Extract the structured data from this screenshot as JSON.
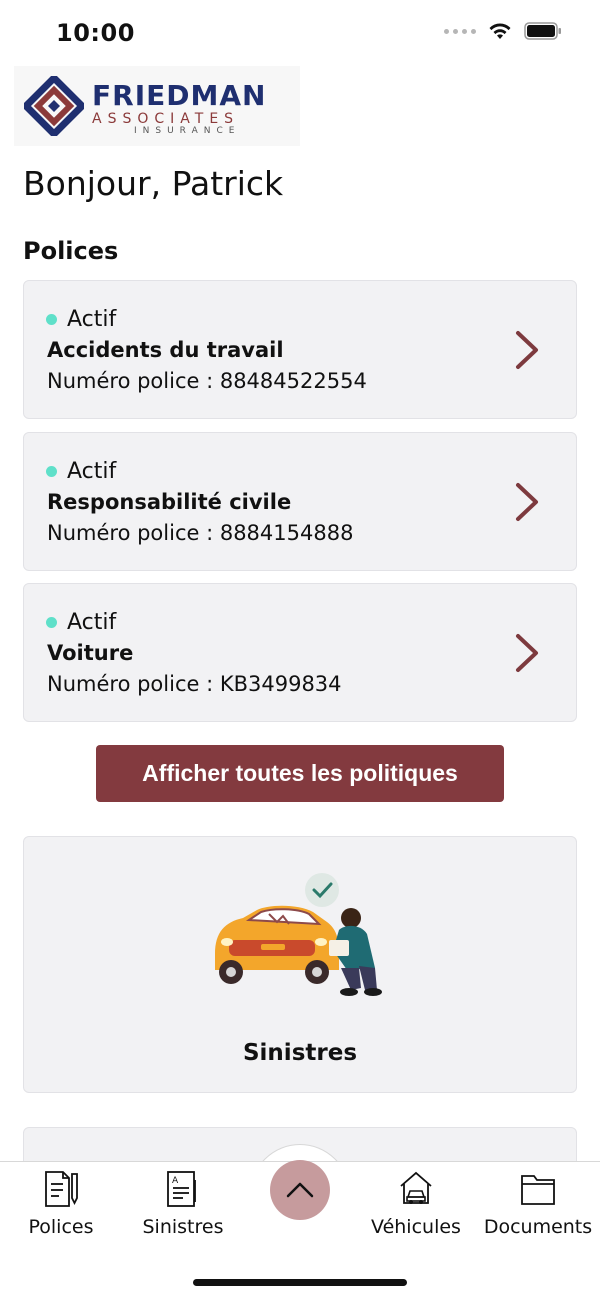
{
  "status_bar": {
    "time": "10:00"
  },
  "logo": {
    "name": "FRIEDMAN",
    "line2": "ASSOCIATES",
    "line3": "INSURANCE"
  },
  "greeting": "Bonjour, Patrick",
  "policies_section": {
    "title": "Polices",
    "items": [
      {
        "status": "Actif",
        "name": "Accidents du travail",
        "number": "Numéro police : 88484522554"
      },
      {
        "status": "Actif",
        "name": "Responsabilité civile",
        "number": "Numéro police : 8884154888"
      },
      {
        "status": "Actif",
        "name": "Voiture",
        "number": "Numéro police : KB3499834"
      }
    ],
    "all_button": "Afficher toutes les politiques"
  },
  "claims_card": {
    "label": "Sinistres"
  },
  "tab_bar": {
    "items": [
      {
        "label": "Polices",
        "icon": "document-pen-icon"
      },
      {
        "label": "Sinistres",
        "icon": "claim-form-icon"
      },
      {
        "label": "Véhicules",
        "icon": "car-house-icon"
      },
      {
        "label": "Documents",
        "icon": "folder-icon"
      }
    ],
    "center_icon": "chevron-up-icon"
  },
  "colors": {
    "accent": "#833a3f",
    "active_dot": "#5fe0c9",
    "card_bg": "#f2f2f4",
    "brand_blue": "#1f2f70"
  }
}
